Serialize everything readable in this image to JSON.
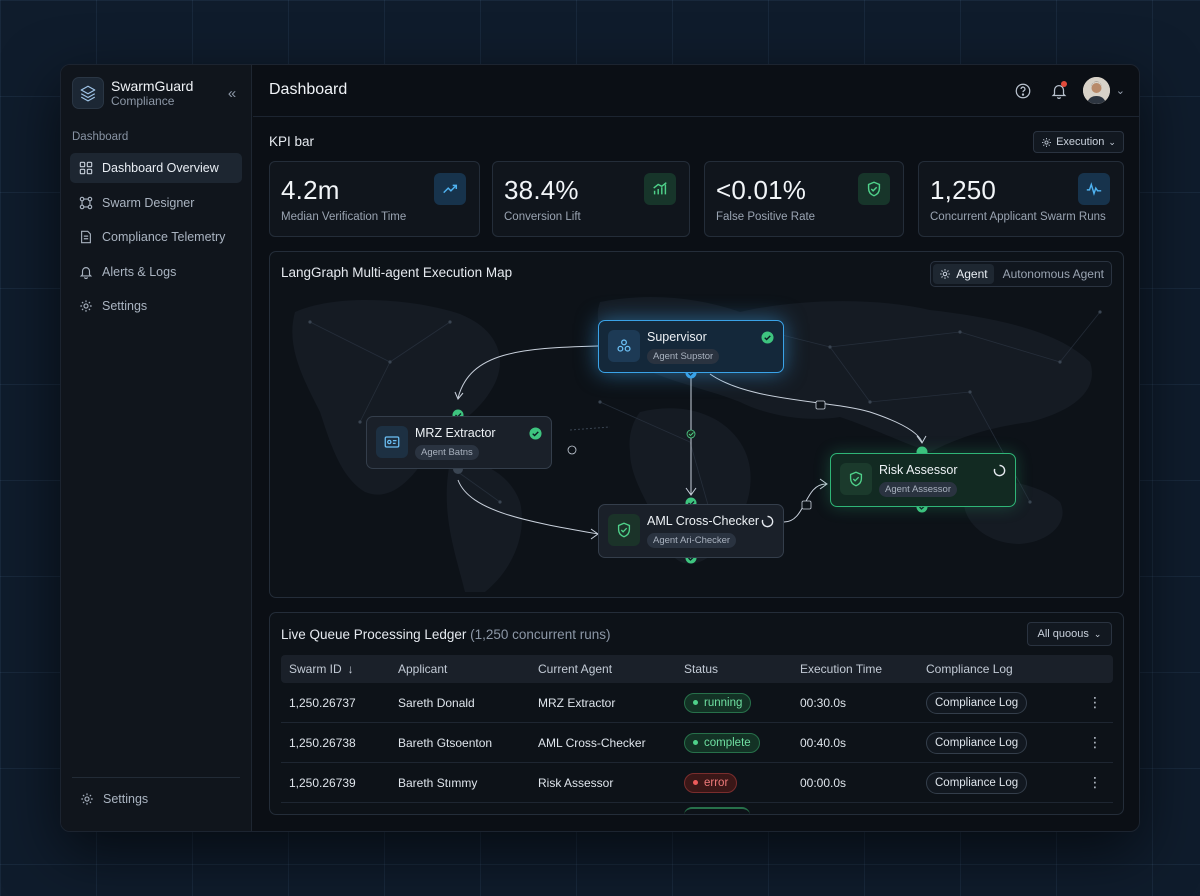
{
  "brand": {
    "name": "SwarmGuard",
    "subtitle": "Compliance"
  },
  "sidebar": {
    "section": "Dashboard",
    "items": [
      {
        "label": "Dashboard Overview",
        "icon": "grid-icon",
        "active": true
      },
      {
        "label": "Swarm Designer",
        "icon": "nodes-icon",
        "active": false
      },
      {
        "label": "Compliance Telemetry",
        "icon": "document-icon",
        "active": false
      },
      {
        "label": "Alerts & Logs",
        "icon": "bell-icon",
        "active": false
      },
      {
        "label": "Settings",
        "icon": "gear-icon",
        "active": false
      }
    ],
    "bottom_label": "Settings"
  },
  "header": {
    "title": "Dashboard"
  },
  "kpi": {
    "title": "KPI bar",
    "filter_label": "Execution",
    "cards": [
      {
        "value": "4.2m",
        "label": "Median Verification Time",
        "icon": "trend-up-icon",
        "accent": "#3aa3e8"
      },
      {
        "value": "38.4%",
        "label": "Conversion Lift",
        "icon": "bar-chart-icon",
        "accent": "#3ec47f"
      },
      {
        "value": "<0.01%",
        "label": "False Positive Rate",
        "icon": "shield-check-icon",
        "accent": "#3ec47f"
      },
      {
        "value": "1,250",
        "label": "Concurrent Applicant Swarm Runs",
        "icon": "pulse-icon",
        "accent": "#3aa3e8"
      }
    ]
  },
  "map": {
    "title": "LangGraph Multi-agent Execution Map",
    "segments": [
      "Agent",
      "Autonomous Agent"
    ],
    "nodes": {
      "supervisor": {
        "name": "Supervisor",
        "sub": "Agent Supstor"
      },
      "mrz": {
        "name": "MRZ Extractor",
        "sub": "Agent Batns"
      },
      "aml": {
        "name": "AML Cross-Checker",
        "sub": "Agent Ari-Checker"
      },
      "risk": {
        "name": "Risk Assessor",
        "sub": "Agent Assessor"
      }
    }
  },
  "ledger": {
    "title": "Live Queue Processing Ledger",
    "subtitle": "(1,250 concurrent runs)",
    "filter_label": "All quoous",
    "columns": [
      "Swarm ID",
      "Applicant",
      "Current Agent",
      "Status",
      "Execution Time",
      "Compliance Log"
    ],
    "rows": [
      {
        "id": "1,250.26737",
        "applicant": "Sareth Donald",
        "agent": "MRZ Extractor",
        "status": "running",
        "time": "00:30.0s",
        "log": "Compliance Log"
      },
      {
        "id": "1,250.26738",
        "applicant": "Bareth Gtsoenton",
        "agent": "AML Cross-Checker",
        "status": "complete",
        "time": "00:40.0s",
        "log": "Compliance Log"
      },
      {
        "id": "1,250.26739",
        "applicant": "Bareth Stımmy",
        "agent": "Risk Assessor",
        "status": "error",
        "time": "00:00.0s",
        "log": "Compliance Log"
      }
    ]
  },
  "colors": {
    "accent_blue": "#3aa3e8",
    "accent_green": "#3ec47f",
    "error_red": "#ef5b5b",
    "bg": "#0b0f15"
  }
}
